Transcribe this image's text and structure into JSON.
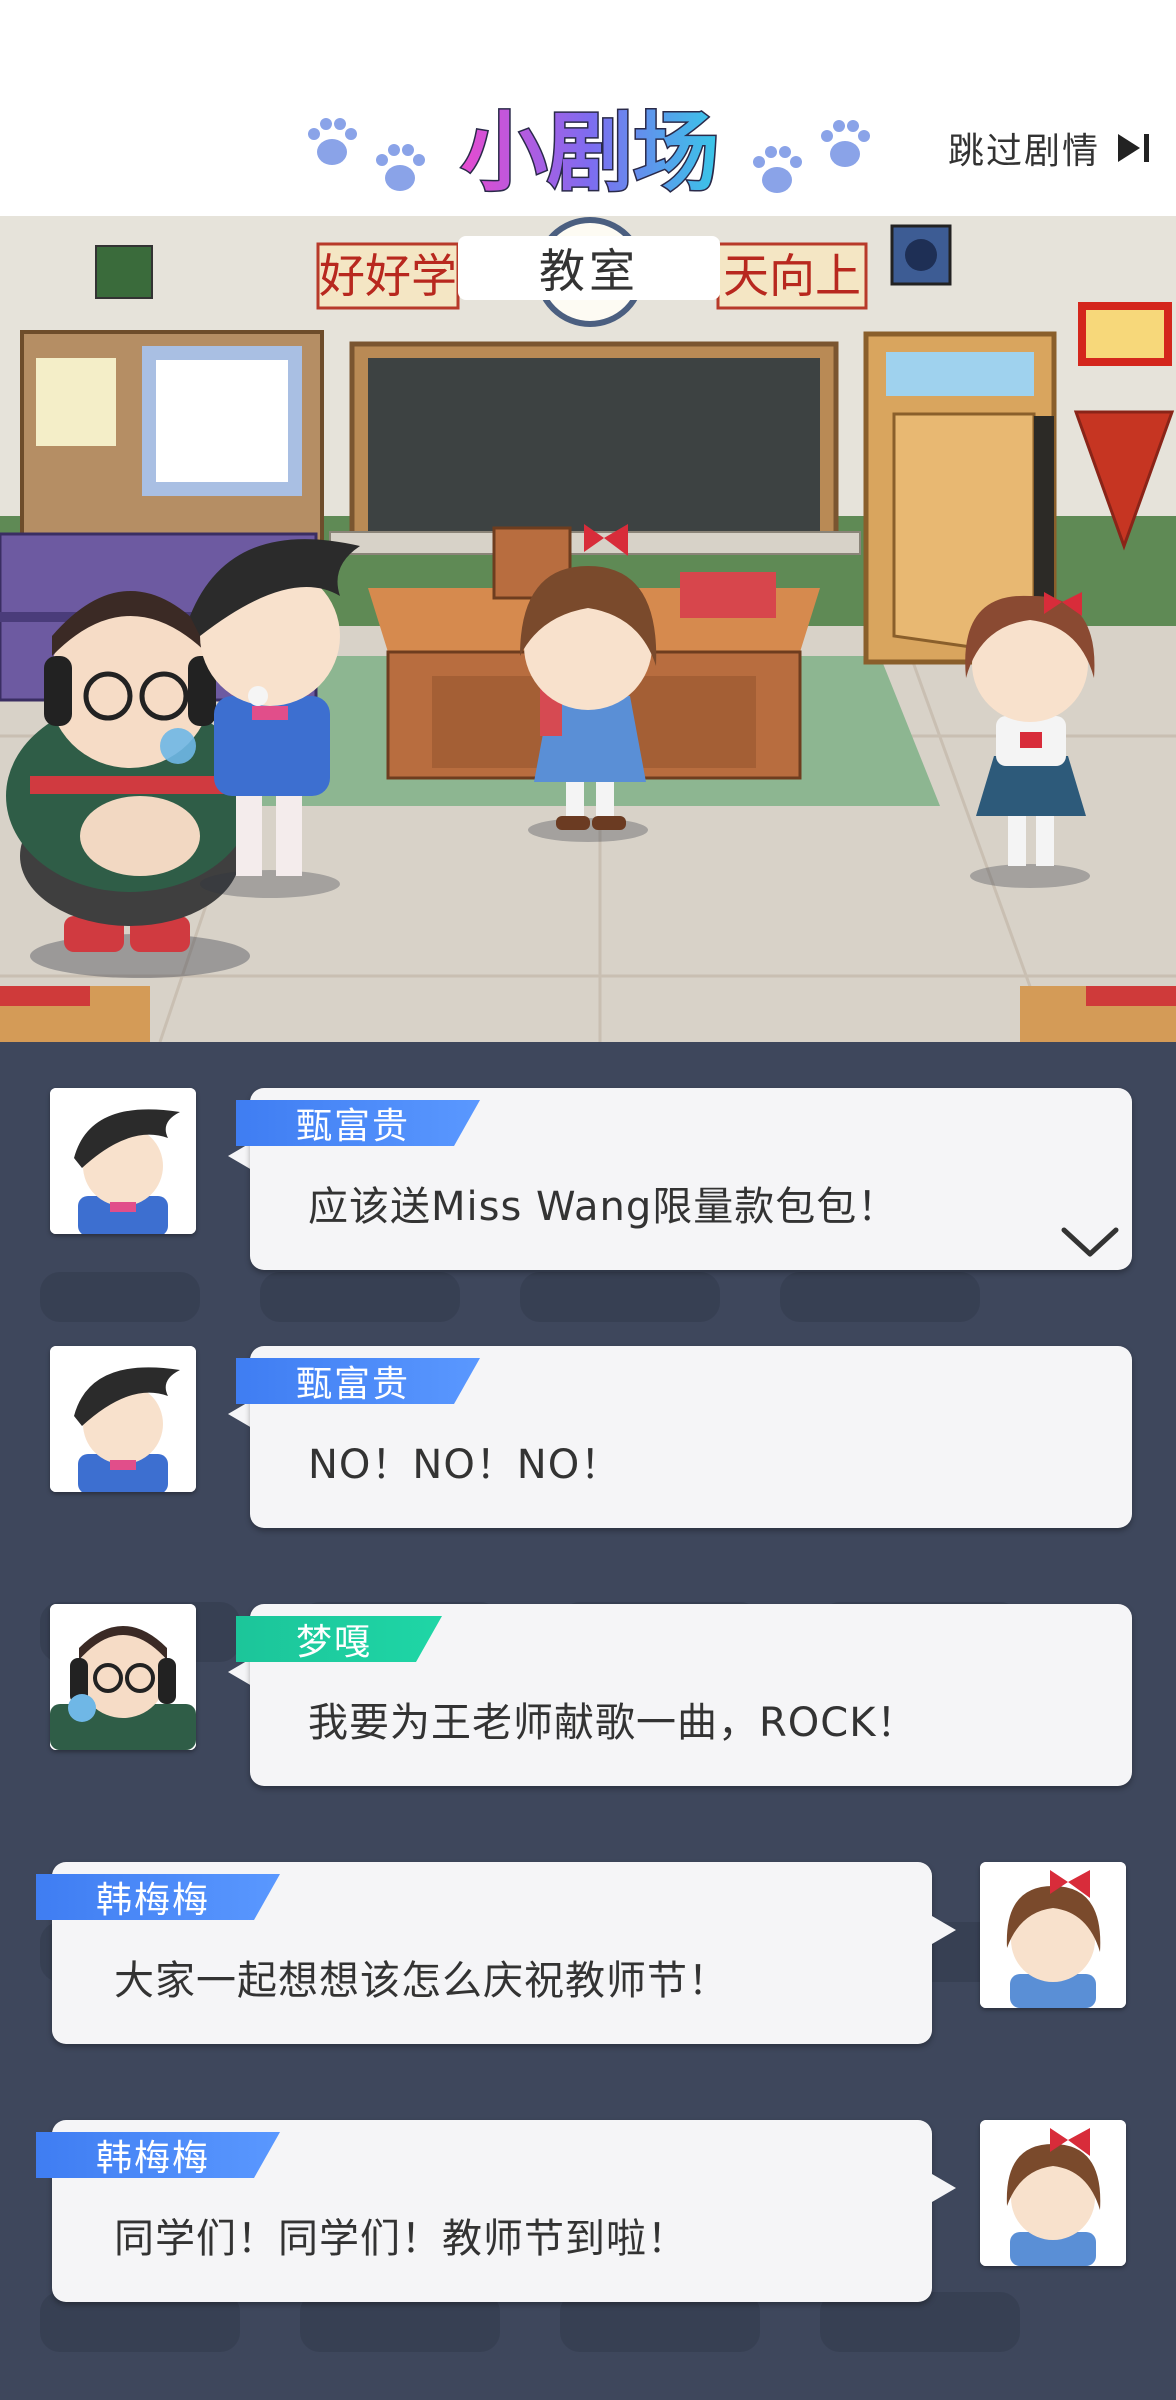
{
  "header": {
    "title": "小剧场",
    "skip_label": "跳过剧情"
  },
  "scene": {
    "location": "教室",
    "banner_left": "好好学",
    "banner_right": "天向上"
  },
  "messages": [
    {
      "speaker": "甄富贵",
      "text": "应该送Miss Wang限量款包包！",
      "side": "left",
      "tag_color": "blue",
      "expanded": true
    },
    {
      "speaker": "甄富贵",
      "text": "NO！NO！NO！",
      "side": "left",
      "tag_color": "blue"
    },
    {
      "speaker": "梦嘎",
      "text": "我要为王老师献歌一曲，ROCK！",
      "side": "left",
      "tag_color": "green"
    },
    {
      "speaker": "韩梅梅",
      "text": "大家一起想想该怎么庆祝教师节！",
      "side": "right",
      "tag_color": "blue"
    },
    {
      "speaker": "韩梅梅",
      "text": "同学们！同学们！教师节到啦！",
      "side": "right",
      "tag_color": "blue"
    }
  ],
  "colors": {
    "tag_blue": "#4a8af5",
    "tag_green": "#1fcf9f",
    "chat_bg": "#3c455b",
    "bubble_bg": "#f5f5f7"
  },
  "icons": {
    "skip": "skip-forward-icon",
    "expand": "chevron-down-icon",
    "paw": "paw-icon"
  }
}
